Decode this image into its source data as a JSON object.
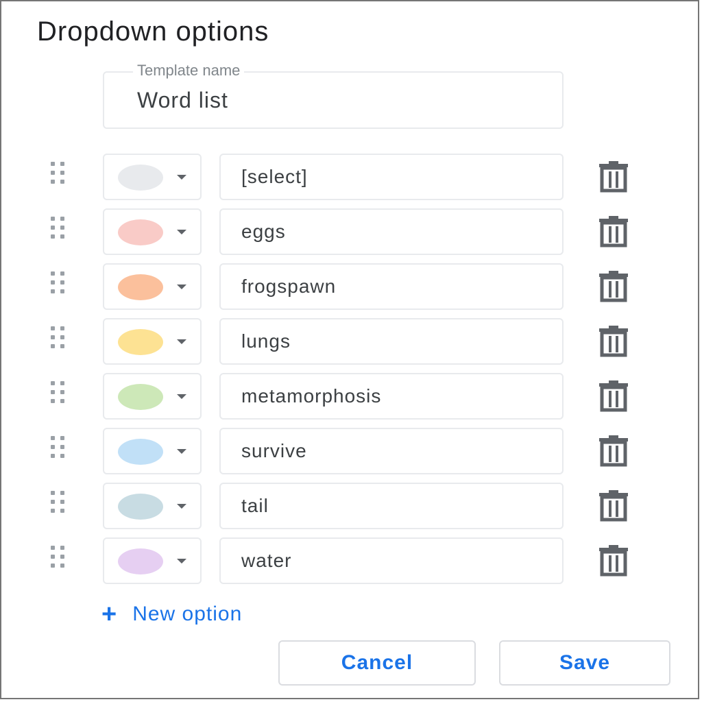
{
  "dialog": {
    "title": "Dropdown options",
    "template_name": {
      "label": "Template name",
      "value": "Word list"
    },
    "options": [
      {
        "label": "[select]",
        "color": "#e8eaed"
      },
      {
        "label": "eggs",
        "color": "#f9cbc7"
      },
      {
        "label": "frogspawn",
        "color": "#fbc09c"
      },
      {
        "label": "lungs",
        "color": "#fde293"
      },
      {
        "label": "metamorphosis",
        "color": "#cde8b8"
      },
      {
        "label": "survive",
        "color": "#c1e0f7"
      },
      {
        "label": "tail",
        "color": "#c8dce3"
      },
      {
        "label": "water",
        "color": "#e6cff2"
      }
    ],
    "new_option_label": "New option",
    "cancel_label": "Cancel",
    "save_label": "Save"
  },
  "icons": {
    "drag": "drag-handle-icon",
    "color_dropdown": "chevron-down-icon",
    "delete": "trash-icon",
    "add": "plus-icon"
  },
  "colors": {
    "accent": "#1a73e8",
    "border": "#e8eaed",
    "icon": "#5f6368"
  }
}
